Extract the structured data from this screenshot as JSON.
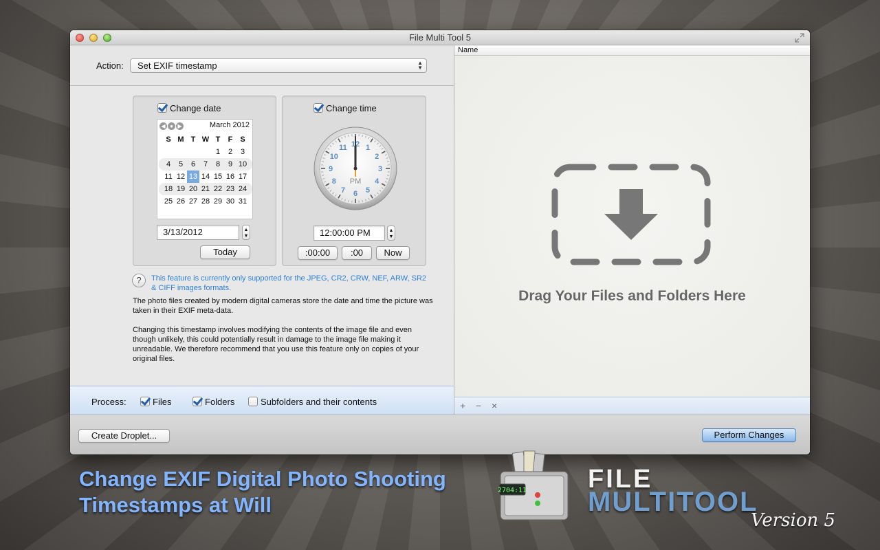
{
  "window": {
    "title": "File Multi Tool 5"
  },
  "action": {
    "label": "Action:",
    "selected": "Set EXIF timestamp"
  },
  "date_panel": {
    "checkbox_label": "Change date",
    "checked": true,
    "calendar": {
      "month_title": "March 2012",
      "weekdays": [
        "S",
        "M",
        "T",
        "W",
        "T",
        "F",
        "S"
      ],
      "weeks": [
        [
          "",
          "",
          "",
          "",
          "1",
          "2",
          "3"
        ],
        [
          "4",
          "5",
          "6",
          "7",
          "8",
          "9",
          "10"
        ],
        [
          "11",
          "12",
          "13",
          "14",
          "15",
          "16",
          "17"
        ],
        [
          "18",
          "19",
          "20",
          "21",
          "22",
          "23",
          "24"
        ],
        [
          "25",
          "26",
          "27",
          "28",
          "29",
          "30",
          "31"
        ]
      ],
      "selected_day": "13"
    },
    "date_value": "3/13/2012",
    "today_button": "Today"
  },
  "time_panel": {
    "checkbox_label": "Change time",
    "checked": true,
    "clock": {
      "period": "PM",
      "hour_labels": [
        "12",
        "1",
        "2",
        "3",
        "4",
        "5",
        "6",
        "7",
        "8",
        "9",
        "10",
        "11"
      ],
      "hour": 12,
      "minute": 0
    },
    "time_value": "12:00:00 PM",
    "buttons": {
      "zero_min_sec": ":00:00",
      "zero_sec": ":00",
      "now": "Now"
    }
  },
  "info": {
    "help_icon": "?",
    "note": "This feature is currently only supported for the JPEG, CR2, CRW, NEF, ARW, SR2 & CIFF images formats.",
    "para1": "The photo files created by modern digital cameras store the date and time the picture was taken in their EXIF meta-data.",
    "para2": "Changing this timestamp involves modifying the contents of the image file and even though unlikely, this could potentially result in damage to the image file making it unreadable. We therefore recommend that you use this feature only on copies of your original files."
  },
  "process": {
    "label": "Process:",
    "files": {
      "label": "Files",
      "checked": true
    },
    "folders": {
      "label": "Folders",
      "checked": true
    },
    "subfolders": {
      "label": "Subfolders and their contents",
      "checked": false
    }
  },
  "file_list": {
    "column_name": "Name",
    "drop_text": "Drag Your Files and Folders Here",
    "footer": {
      "add": "+",
      "remove": "−",
      "clear": "×"
    }
  },
  "bottom": {
    "create_droplet": "Create Droplet...",
    "perform_changes": "Perform Changes"
  },
  "promo": {
    "line1": "Change EXIF Digital Photo Shooting",
    "line2": "Timestamps at Will"
  },
  "logo": {
    "word1": "FILE",
    "word2": "MULTITOOL",
    "version": "Version 5",
    "display": "2704:11"
  },
  "colors": {
    "accent_blue": "#2e7fd6",
    "selection": "#7aa9dc",
    "promo_blue": "#82b5ff"
  }
}
